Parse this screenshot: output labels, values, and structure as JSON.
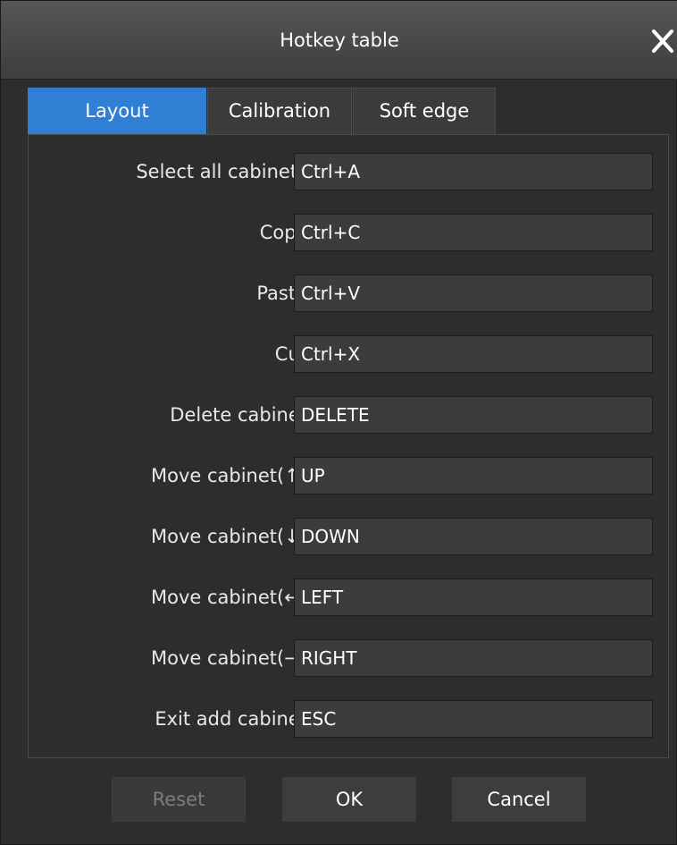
{
  "window": {
    "title": "Hotkey table",
    "close_icon": "close-icon"
  },
  "tabs": [
    {
      "label": "Layout",
      "active": true
    },
    {
      "label": "Calibration",
      "active": false
    },
    {
      "label": "Soft edge",
      "active": false
    }
  ],
  "hotkeys": [
    {
      "label": "Select all cabinets",
      "value": "Ctrl+A"
    },
    {
      "label": "Copy",
      "value": "Ctrl+C"
    },
    {
      "label": "Paste",
      "value": "Ctrl+V"
    },
    {
      "label": "Cut",
      "value": "Ctrl+X"
    },
    {
      "label": "Delete cabinet",
      "value": "DELETE"
    },
    {
      "label": "Move cabinet(↑)",
      "value": "UP"
    },
    {
      "label": "Move cabinet(↓)",
      "value": "DOWN"
    },
    {
      "label": "Move cabinet(←)",
      "value": "LEFT"
    },
    {
      "label": "Move cabinet(→)",
      "value": "RIGHT"
    },
    {
      "label": "Exit add cabinet",
      "value": "ESC"
    }
  ],
  "buttons": {
    "reset_label": "Reset",
    "reset_enabled": false,
    "ok_label": "OK",
    "cancel_label": "Cancel"
  },
  "colors": {
    "active_tab": "#2f7fd4",
    "background": "#2d2d2d",
    "field_background": "#3c3c3c"
  }
}
